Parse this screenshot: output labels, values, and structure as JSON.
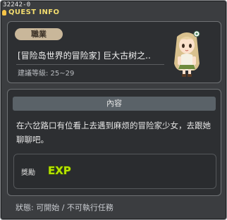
{
  "window": {
    "quest_id": "32242-0",
    "title": "QUEST INFO"
  },
  "quest": {
    "job_badge": "職業",
    "name": "[冒险岛世界的冒险家] 巨大古树之..",
    "level": "建議等級: 25~29",
    "npc_icon": "girl-npc-portrait"
  },
  "content": {
    "header": "內容",
    "description": "在六岔路口有位看上去遇到麻烦的冒险家少女，去跟她聊聊吧。"
  },
  "reward": {
    "label": "獎勵",
    "exp_label": "EXP"
  },
  "status": {
    "text": "狀態:  可開始 / 不可執行任務"
  }
}
